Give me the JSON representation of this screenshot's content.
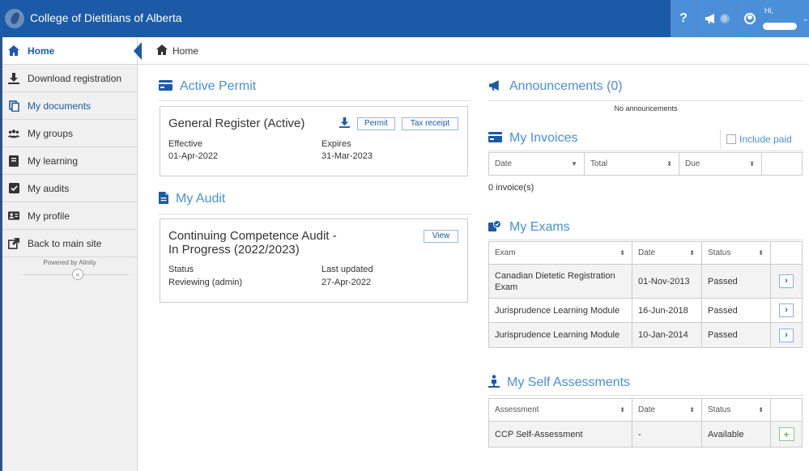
{
  "app": {
    "title": "College of Dietitians of Alberta"
  },
  "topbar": {
    "help": "?",
    "announcements_count": "0",
    "user_greeting": "Hi,"
  },
  "sidebar": {
    "items": [
      {
        "label": "Home",
        "icon": "home-icon"
      },
      {
        "label": "Download registration",
        "icon": "download-icon"
      },
      {
        "label": "My documents",
        "icon": "documents-icon"
      },
      {
        "label": "My groups",
        "icon": "groups-icon"
      },
      {
        "label": "My learning",
        "icon": "book-icon"
      },
      {
        "label": "My audits",
        "icon": "checkbox-icon"
      },
      {
        "label": "My profile",
        "icon": "id-card-icon"
      },
      {
        "label": "Back to main site",
        "icon": "external-link-icon"
      }
    ],
    "powered": "Powered by Alinity",
    "collapse": "«"
  },
  "breadcrumb": {
    "label": "Home"
  },
  "permit": {
    "title": "Active Permit",
    "register": "General Register (Active)",
    "btn_permit": "Permit",
    "btn_tax": "Tax receipt",
    "effective_label": "Effective",
    "effective": "01-Apr-2022",
    "expires_label": "Expires",
    "expires": "31-Mar-2023"
  },
  "audit": {
    "title": "My Audit",
    "name": "Continuing Competence Audit - In Progress (2022/2023)",
    "name_line1": "Continuing Competence Audit -",
    "name_line2": "In Progress (2022/2023)",
    "btn_view": "View",
    "status_label": "Status",
    "status": "Reviewing (admin)",
    "updated_label": "Last updated",
    "updated": "27-Apr-2022"
  },
  "announcements": {
    "title": "Announcements (0)",
    "empty": "No announcements"
  },
  "invoices": {
    "title": "My Invoices",
    "include_paid": "Include paid",
    "headers": [
      "Date",
      "Total",
      "Due"
    ],
    "count": "0 invoice(s)"
  },
  "exams": {
    "title": "My Exams",
    "headers": [
      "Exam",
      "Date",
      "Status"
    ],
    "rows": [
      {
        "exam": "Canadian Dietetic Registration Exam",
        "exam_line1": "Canadian Dietetic Registration",
        "exam_line2": "Exam",
        "date": "01-Nov-2013",
        "status": "Passed"
      },
      {
        "exam": "Jurisprudence Learning Module",
        "date": "16-Jun-2018",
        "status": "Passed"
      },
      {
        "exam": "Jurisprudence Learning Module",
        "date": "10-Jan-2014",
        "status": "Passed"
      }
    ]
  },
  "assessments": {
    "title": "My Self Assessments",
    "headers": [
      "Assessment",
      "Date",
      "Status"
    ],
    "rows": [
      {
        "assessment": "CCP Self-Assessment",
        "date": "-",
        "status": "Available"
      }
    ]
  },
  "colors": {
    "topbar": "#1b5aa6",
    "accent": "#4a8fd8",
    "available": "#4aa14a"
  }
}
